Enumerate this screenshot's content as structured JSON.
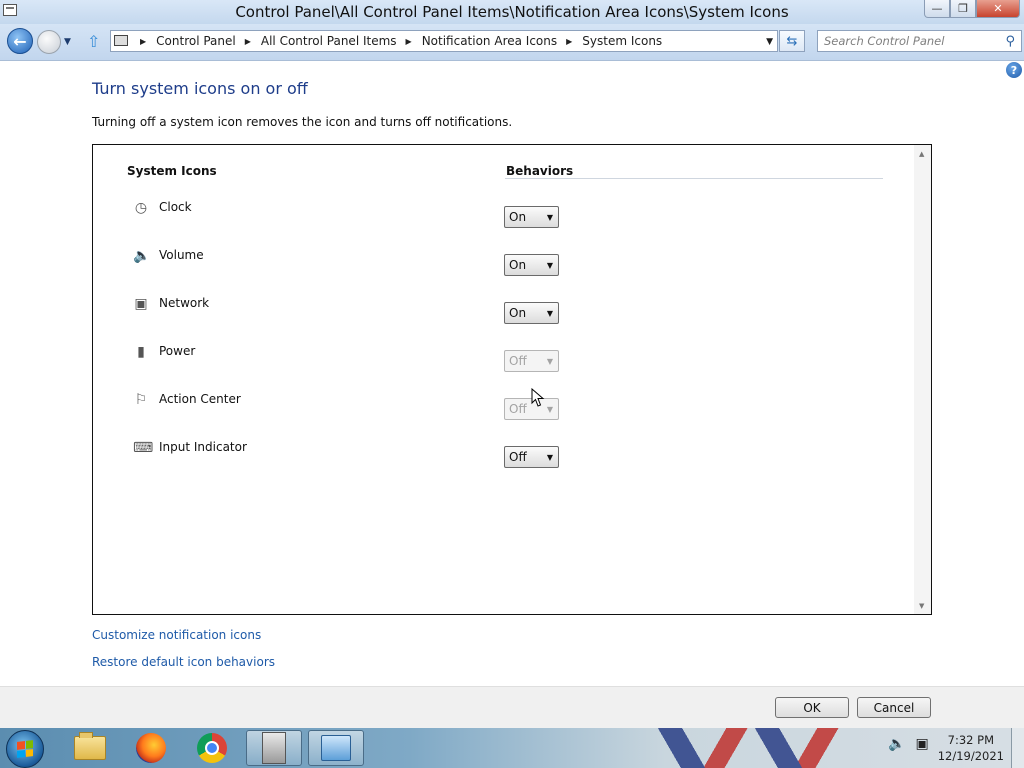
{
  "window": {
    "title": "Control Panel\\All Control Panel Items\\Notification Area Icons\\System Icons"
  },
  "nav": {
    "breadcrumbs": [
      "Control Panel",
      "All Control Panel Items",
      "Notification Area Icons",
      "System Icons"
    ],
    "search_placeholder": "Search Control Panel"
  },
  "content": {
    "heading": "Turn system icons on or off",
    "description": "Turning off a system icon removes the icon and turns off notifications.",
    "col_icons": "System Icons",
    "col_behaviors": "Behaviors",
    "rows": [
      {
        "label": "Clock",
        "icon": "clock-icon",
        "value": "On",
        "enabled": true
      },
      {
        "label": "Volume",
        "icon": "volume-icon",
        "value": "On",
        "enabled": true
      },
      {
        "label": "Network",
        "icon": "network-icon",
        "value": "On",
        "enabled": true
      },
      {
        "label": "Power",
        "icon": "power-icon",
        "value": "Off",
        "enabled": false
      },
      {
        "label": "Action Center",
        "icon": "flag-icon",
        "value": "Off",
        "enabled": false
      },
      {
        "label": "Input Indicator",
        "icon": "keyboard-icon",
        "value": "Off",
        "enabled": true
      }
    ],
    "link_customize": "Customize notification icons",
    "link_restore": "Restore default icon behaviors"
  },
  "buttons": {
    "ok": "OK",
    "cancel": "Cancel"
  },
  "taskbar": {
    "time": "7:32 PM",
    "date": "12/19/2021",
    "apps": [
      "windows-explorer",
      "firefox",
      "chrome",
      "computer",
      "control-panel"
    ]
  }
}
